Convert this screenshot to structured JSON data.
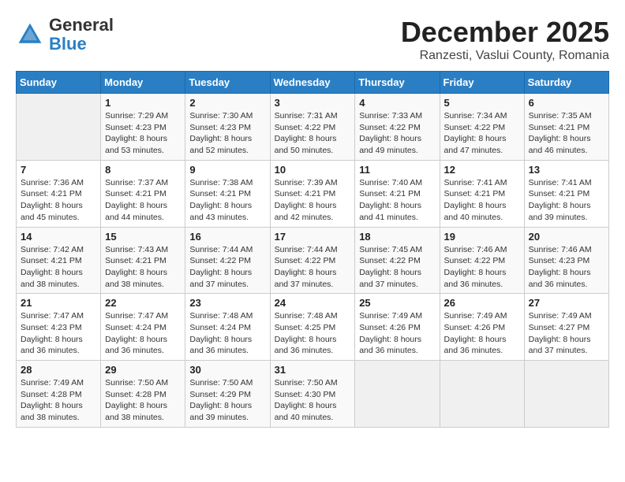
{
  "logo": {
    "general": "General",
    "blue": "Blue"
  },
  "title": "December 2025",
  "subtitle": "Ranzesti, Vaslui County, Romania",
  "days_header": [
    "Sunday",
    "Monday",
    "Tuesday",
    "Wednesday",
    "Thursday",
    "Friday",
    "Saturday"
  ],
  "weeks": [
    [
      {
        "day": "",
        "info": ""
      },
      {
        "day": "1",
        "info": "Sunrise: 7:29 AM\nSunset: 4:23 PM\nDaylight: 8 hours\nand 53 minutes."
      },
      {
        "day": "2",
        "info": "Sunrise: 7:30 AM\nSunset: 4:23 PM\nDaylight: 8 hours\nand 52 minutes."
      },
      {
        "day": "3",
        "info": "Sunrise: 7:31 AM\nSunset: 4:22 PM\nDaylight: 8 hours\nand 50 minutes."
      },
      {
        "day": "4",
        "info": "Sunrise: 7:33 AM\nSunset: 4:22 PM\nDaylight: 8 hours\nand 49 minutes."
      },
      {
        "day": "5",
        "info": "Sunrise: 7:34 AM\nSunset: 4:22 PM\nDaylight: 8 hours\nand 47 minutes."
      },
      {
        "day": "6",
        "info": "Sunrise: 7:35 AM\nSunset: 4:21 PM\nDaylight: 8 hours\nand 46 minutes."
      }
    ],
    [
      {
        "day": "7",
        "info": "Sunrise: 7:36 AM\nSunset: 4:21 PM\nDaylight: 8 hours\nand 45 minutes."
      },
      {
        "day": "8",
        "info": "Sunrise: 7:37 AM\nSunset: 4:21 PM\nDaylight: 8 hours\nand 44 minutes."
      },
      {
        "day": "9",
        "info": "Sunrise: 7:38 AM\nSunset: 4:21 PM\nDaylight: 8 hours\nand 43 minutes."
      },
      {
        "day": "10",
        "info": "Sunrise: 7:39 AM\nSunset: 4:21 PM\nDaylight: 8 hours\nand 42 minutes."
      },
      {
        "day": "11",
        "info": "Sunrise: 7:40 AM\nSunset: 4:21 PM\nDaylight: 8 hours\nand 41 minutes."
      },
      {
        "day": "12",
        "info": "Sunrise: 7:41 AM\nSunset: 4:21 PM\nDaylight: 8 hours\nand 40 minutes."
      },
      {
        "day": "13",
        "info": "Sunrise: 7:41 AM\nSunset: 4:21 PM\nDaylight: 8 hours\nand 39 minutes."
      }
    ],
    [
      {
        "day": "14",
        "info": "Sunrise: 7:42 AM\nSunset: 4:21 PM\nDaylight: 8 hours\nand 38 minutes."
      },
      {
        "day": "15",
        "info": "Sunrise: 7:43 AM\nSunset: 4:21 PM\nDaylight: 8 hours\nand 38 minutes."
      },
      {
        "day": "16",
        "info": "Sunrise: 7:44 AM\nSunset: 4:22 PM\nDaylight: 8 hours\nand 37 minutes."
      },
      {
        "day": "17",
        "info": "Sunrise: 7:44 AM\nSunset: 4:22 PM\nDaylight: 8 hours\nand 37 minutes."
      },
      {
        "day": "18",
        "info": "Sunrise: 7:45 AM\nSunset: 4:22 PM\nDaylight: 8 hours\nand 37 minutes."
      },
      {
        "day": "19",
        "info": "Sunrise: 7:46 AM\nSunset: 4:22 PM\nDaylight: 8 hours\nand 36 minutes."
      },
      {
        "day": "20",
        "info": "Sunrise: 7:46 AM\nSunset: 4:23 PM\nDaylight: 8 hours\nand 36 minutes."
      }
    ],
    [
      {
        "day": "21",
        "info": "Sunrise: 7:47 AM\nSunset: 4:23 PM\nDaylight: 8 hours\nand 36 minutes."
      },
      {
        "day": "22",
        "info": "Sunrise: 7:47 AM\nSunset: 4:24 PM\nDaylight: 8 hours\nand 36 minutes."
      },
      {
        "day": "23",
        "info": "Sunrise: 7:48 AM\nSunset: 4:24 PM\nDaylight: 8 hours\nand 36 minutes."
      },
      {
        "day": "24",
        "info": "Sunrise: 7:48 AM\nSunset: 4:25 PM\nDaylight: 8 hours\nand 36 minutes."
      },
      {
        "day": "25",
        "info": "Sunrise: 7:49 AM\nSunset: 4:26 PM\nDaylight: 8 hours\nand 36 minutes."
      },
      {
        "day": "26",
        "info": "Sunrise: 7:49 AM\nSunset: 4:26 PM\nDaylight: 8 hours\nand 36 minutes."
      },
      {
        "day": "27",
        "info": "Sunrise: 7:49 AM\nSunset: 4:27 PM\nDaylight: 8 hours\nand 37 minutes."
      }
    ],
    [
      {
        "day": "28",
        "info": "Sunrise: 7:49 AM\nSunset: 4:28 PM\nDaylight: 8 hours\nand 38 minutes."
      },
      {
        "day": "29",
        "info": "Sunrise: 7:50 AM\nSunset: 4:28 PM\nDaylight: 8 hours\nand 38 minutes."
      },
      {
        "day": "30",
        "info": "Sunrise: 7:50 AM\nSunset: 4:29 PM\nDaylight: 8 hours\nand 39 minutes."
      },
      {
        "day": "31",
        "info": "Sunrise: 7:50 AM\nSunset: 4:30 PM\nDaylight: 8 hours\nand 40 minutes."
      },
      {
        "day": "",
        "info": ""
      },
      {
        "day": "",
        "info": ""
      },
      {
        "day": "",
        "info": ""
      }
    ]
  ]
}
